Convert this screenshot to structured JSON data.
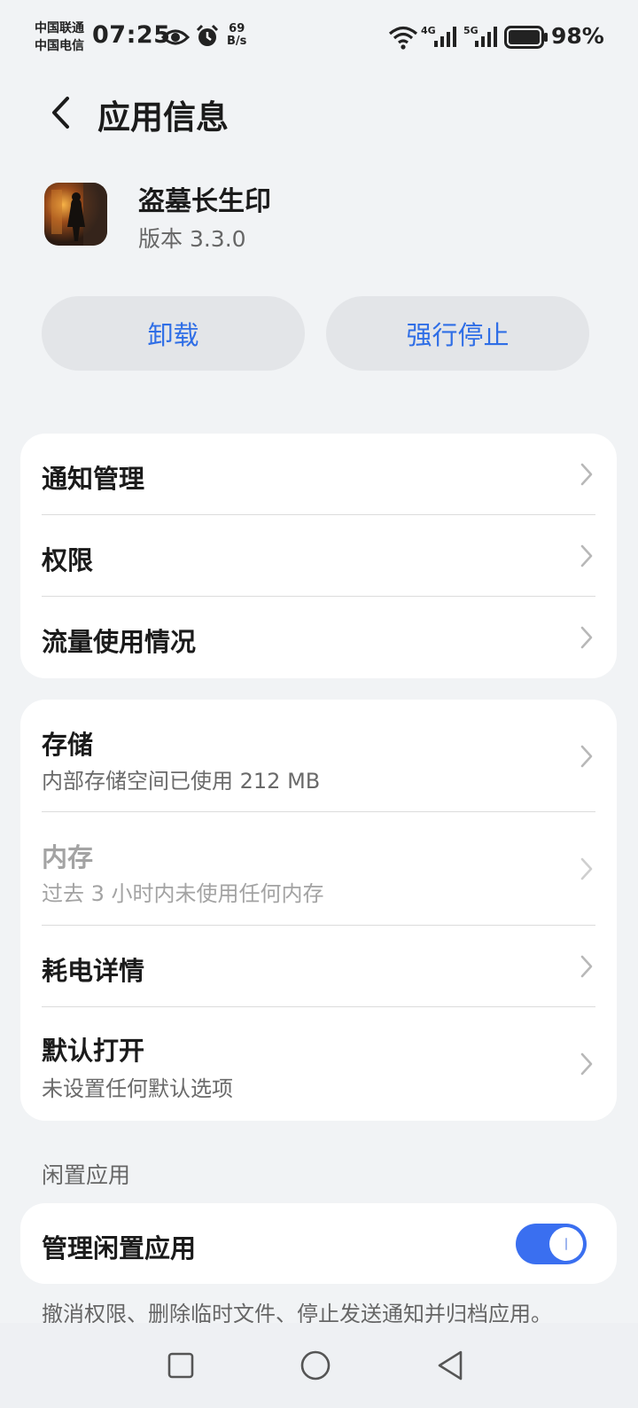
{
  "status_bar": {
    "carrier_1": "中国联通",
    "carrier_2": "中国电信",
    "time": "07:25",
    "net_speed_value": "69",
    "net_speed_unit": "B/s",
    "network_1": "4G",
    "network_2": "5G",
    "battery": "98%",
    "icons": [
      "eye-icon",
      "alarm-icon",
      "wifi-icon",
      "signal-icon",
      "battery-icon"
    ]
  },
  "header": {
    "title": "应用信息",
    "back_icon": "chevron-left-icon"
  },
  "app": {
    "name": "盗墓长生印",
    "version": "版本 3.3.0"
  },
  "actions": {
    "uninstall": "卸载",
    "force_stop": "强行停止",
    "accent_color": "#2f6ee6"
  },
  "group1": {
    "items": [
      {
        "title": "通知管理"
      },
      {
        "title": "权限"
      },
      {
        "title": "流量使用情况"
      }
    ]
  },
  "group2": {
    "items": [
      {
        "title": "存储",
        "subtitle": "内部存储空间已使用 212 MB"
      },
      {
        "title": "内存",
        "subtitle": "过去 3 小时内未使用任何内存",
        "disabled": true
      },
      {
        "title": "耗电详情"
      },
      {
        "title": "默认打开",
        "subtitle": "未设置任何默认选项"
      }
    ]
  },
  "idle_section": {
    "label": "闲置应用",
    "manage_label": "管理闲置应用",
    "toggle_on": true,
    "toggle_color": "#3a6ff0",
    "footnote": "撤消权限、删除临时文件、停止发送通知并归档应用。"
  },
  "nav": {
    "icons": [
      "square-icon",
      "circle-icon",
      "triangle-back-icon"
    ]
  }
}
